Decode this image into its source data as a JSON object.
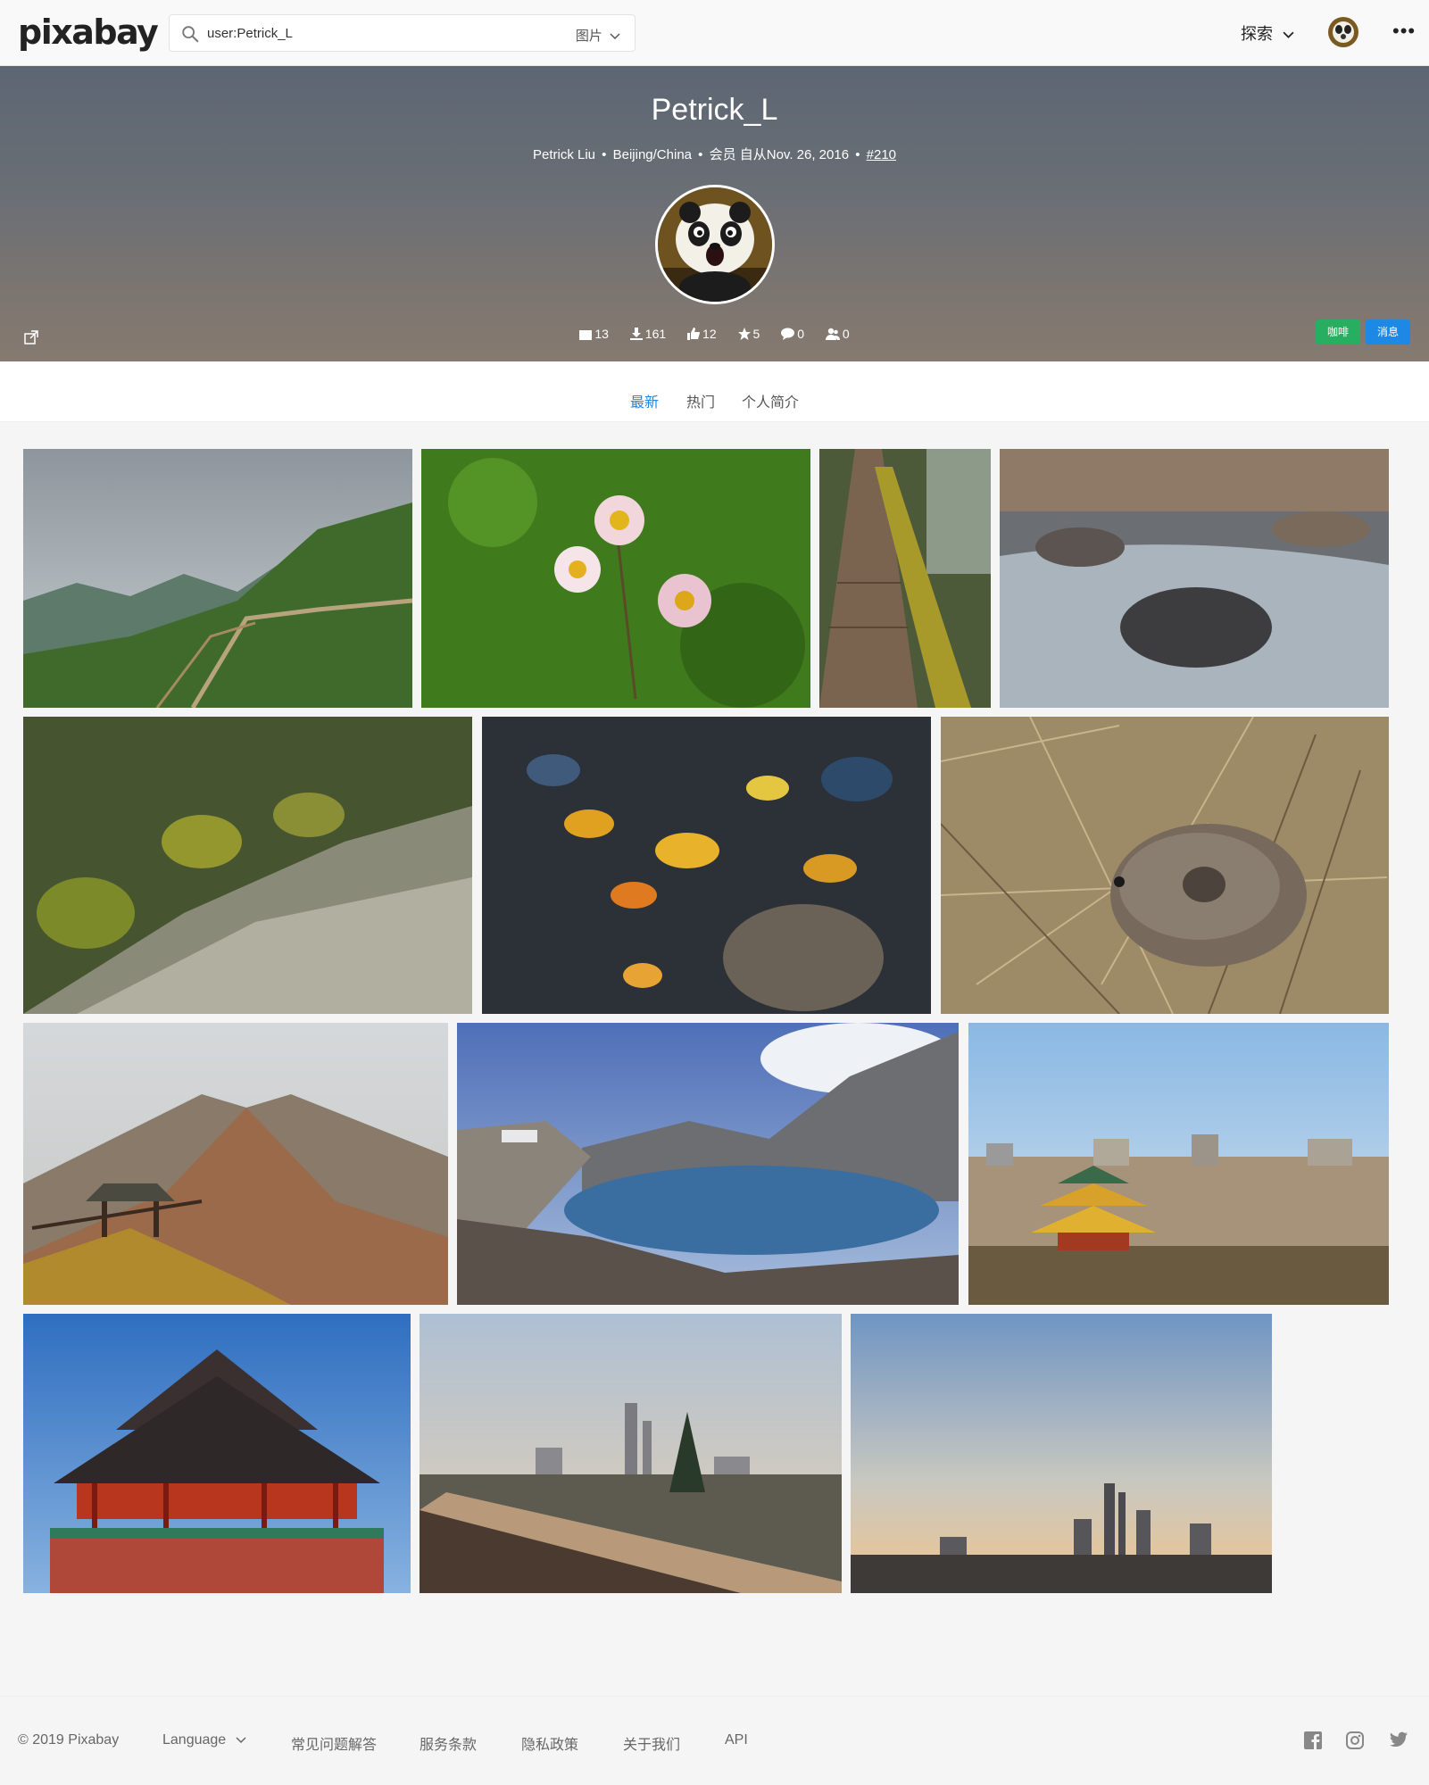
{
  "header": {
    "logo": "pixabay",
    "search_value": "user:Petrick_L",
    "search_type": "图片",
    "explore_label": "探索",
    "more_label": "•••"
  },
  "profile": {
    "username": "Petrick_L",
    "full_name": "Petrick Liu",
    "location": "Beijing/China",
    "member_since": "会员 自从Nov. 26, 2016",
    "rank": "#210",
    "stats": {
      "images": "13",
      "downloads": "161",
      "likes": "12",
      "favorites": "5",
      "comments": "0",
      "followers": "0"
    },
    "coffee_label": "咖啡",
    "message_label": "消息"
  },
  "tabs": [
    {
      "label": "最新",
      "active": true
    },
    {
      "label": "热门",
      "active": false
    },
    {
      "label": "个人简介",
      "active": false
    }
  ],
  "photos": [
    {
      "subject": "mountain-road"
    },
    {
      "subject": "anemone-flowers"
    },
    {
      "subject": "mossy-boardwalk"
    },
    {
      "subject": "river-rocks"
    },
    {
      "subject": "mossy-stream"
    },
    {
      "subject": "autumn-leaves-pebbles"
    },
    {
      "subject": "pika-in-grass"
    },
    {
      "subject": "mountain-pavilion"
    },
    {
      "subject": "mountain-lake"
    },
    {
      "subject": "beijing-skyline-pavilion"
    },
    {
      "subject": "chinese-tower"
    },
    {
      "subject": "city-railing-sunset"
    },
    {
      "subject": "cbd-skyline-dusk"
    }
  ],
  "footer": {
    "copyright": "© 2019 Pixabay",
    "language": "Language",
    "links": [
      "常见问题解答",
      "服务条款",
      "隐私政策",
      "关于我们",
      "API"
    ]
  },
  "colors": {
    "accent": "#1e88e5",
    "coffee": "#27ae60"
  }
}
